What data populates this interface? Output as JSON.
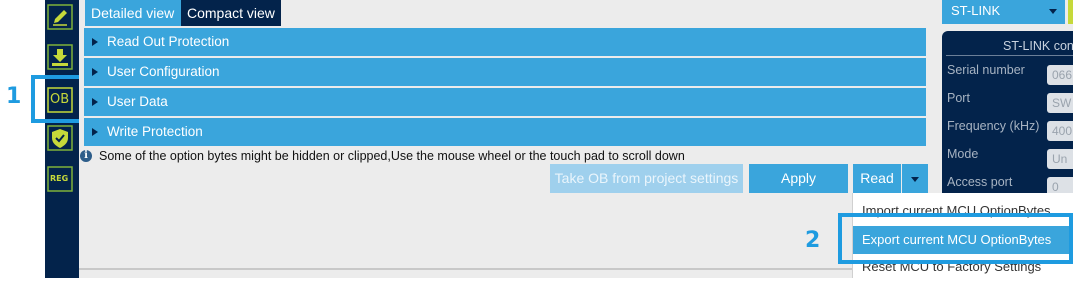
{
  "callouts": {
    "one": "1",
    "two": "2"
  },
  "rail": {
    "ob_label": "OB",
    "reg_label": "REG"
  },
  "tabs": [
    {
      "label": "Detailed view"
    },
    {
      "label": "Compact view"
    }
  ],
  "sections": [
    {
      "label": "Read Out Protection"
    },
    {
      "label": "User Configuration"
    },
    {
      "label": "User Data"
    },
    {
      "label": "Write Protection"
    }
  ],
  "info": {
    "icon": "i",
    "text": "Some of the option bytes might be hidden or clipped,Use the mouse wheel or the touch pad to scroll down"
  },
  "buttons": {
    "take_ob": "Take OB from project settings",
    "apply": "Apply",
    "read": "Read"
  },
  "menu": {
    "items": [
      {
        "label": "Import current MCU OptionBytes"
      },
      {
        "label": "Export current MCU OptionBytes"
      },
      {
        "label": "Reset  MCU to Factory Settings"
      }
    ],
    "selected_index": 1
  },
  "right_panel": {
    "probe_select": "ST-LINK",
    "config_title": "ST-LINK con",
    "fields": [
      {
        "label": "Serial number",
        "value": "066"
      },
      {
        "label": "Port",
        "value": "SW"
      },
      {
        "label": "Frequency (kHz)",
        "value": "400"
      },
      {
        "label": "Mode",
        "value": "Un"
      },
      {
        "label": "Access port",
        "value": "0"
      }
    ]
  },
  "colors": {
    "accent": "#3aa5dc",
    "navy": "#03234b",
    "callout": "#1e9be0",
    "lime": "#c6d93a"
  }
}
